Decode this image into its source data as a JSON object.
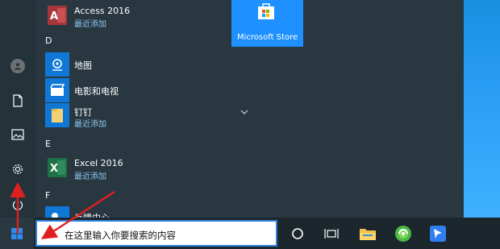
{
  "start_menu": {
    "groups": [
      {
        "letter": "D"
      },
      {
        "letter": "E"
      },
      {
        "letter": "F"
      }
    ],
    "apps": [
      {
        "name": "Access 2016",
        "sub": "最近添加"
      },
      {
        "name": "地图"
      },
      {
        "name": "电影和电视"
      },
      {
        "name": "钉钉",
        "sub": "最近添加"
      },
      {
        "name": "Excel 2016",
        "sub": "最近添加"
      },
      {
        "name": "反馈中心"
      }
    ],
    "tiles": [
      {
        "name": "Microsoft Store"
      }
    ],
    "rail_icons": [
      "user-icon",
      "document-icon",
      "pictures-icon",
      "settings-icon",
      "power-icon"
    ]
  },
  "taskbar": {
    "search_placeholder": "在这里输入你要搜索的内容",
    "pinned": [
      "cortana-icon",
      "task-view-icon",
      "file-explorer-icon",
      "browser-icon",
      "feishu-icon"
    ]
  },
  "colors": {
    "accent": "#1e90ff",
    "access_red": "#a4373a",
    "excel_green": "#1e7145",
    "annotation_arrow": "#e02020"
  }
}
